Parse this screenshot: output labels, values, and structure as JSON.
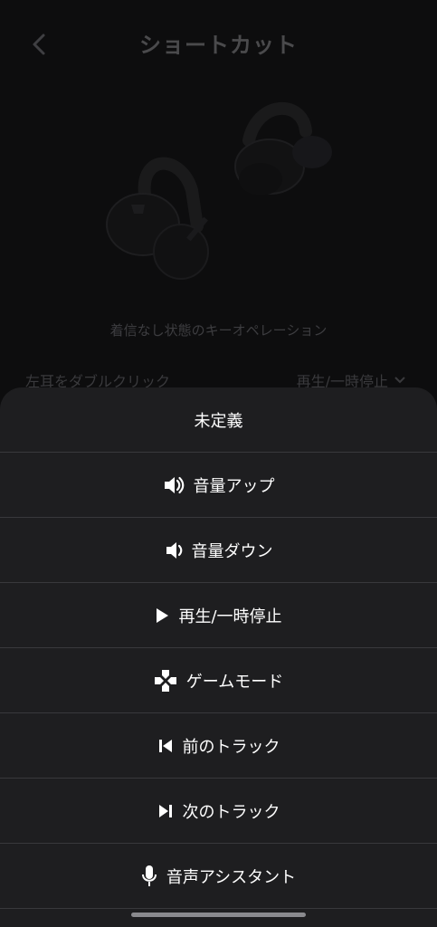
{
  "header": {
    "title": "ショートカット",
    "back_icon": "chevron-left-icon"
  },
  "device": {
    "subtitle": "着信なし状態のキーオペレーション"
  },
  "setting_row": {
    "label": "左耳をダブルクリック",
    "value": "再生/一時停止"
  },
  "menu": {
    "items": [
      {
        "label": "未定義",
        "icon": ""
      },
      {
        "label": "音量アップ",
        "icon": "volume-up-icon"
      },
      {
        "label": "音量ダウン",
        "icon": "volume-down-icon"
      },
      {
        "label": "再生/一時停止",
        "icon": "play-icon"
      },
      {
        "label": "ゲームモード",
        "icon": "gamepad-icon"
      },
      {
        "label": "前のトラック",
        "icon": "previous-track-icon"
      },
      {
        "label": "次のトラック",
        "icon": "next-track-icon"
      },
      {
        "label": "音声アシスタント",
        "icon": "microphone-icon"
      }
    ]
  },
  "colors": {
    "sheet_bg": "#1e1e20",
    "divider": "#39393c",
    "dimmed_text": "#3d3d40"
  }
}
